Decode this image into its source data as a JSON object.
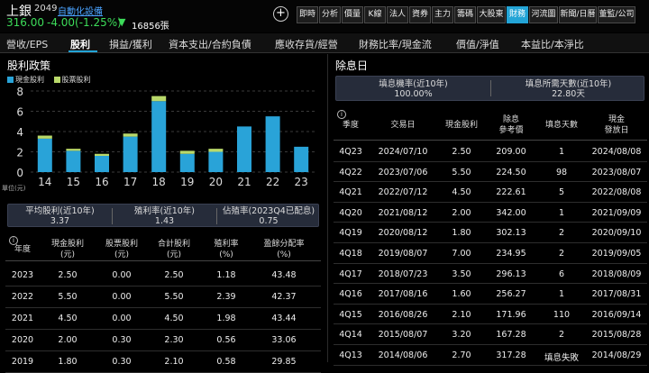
{
  "stock": {
    "name": "上銀",
    "code": "2049",
    "industry": "自動化設備",
    "price": "316.00",
    "change": "-4.00(-1.25%)",
    "arrow": "▼",
    "volume": "16856張"
  },
  "toolbar": {
    "plus": "+",
    "buttons": [
      "即時",
      "分析",
      "價量",
      "K線",
      "法人",
      "資券",
      "主力",
      "籌碼",
      "大股東",
      "財務",
      "河流圖",
      "新聞/日曆",
      "董監/公司"
    ],
    "active_index": 9
  },
  "nav": {
    "items": [
      "營收/EPS",
      "股利",
      "損益/獲利",
      "資本支出/合約負債",
      "應收存貨/經營",
      "財務比率/現金流",
      "價值/淨值",
      "本益比/本淨比"
    ],
    "active_index": 1
  },
  "dividend_policy": {
    "title": "股利政策",
    "legend": [
      "現金股利",
      "股票股利"
    ],
    "unit": "單位(元)",
    "summary": [
      {
        "label": "平均股利(近10年)",
        "value": "3.37"
      },
      {
        "label": "殖利率(近10年)",
        "value": "1.43"
      },
      {
        "label": "佔殖率(2023Q4已配息)",
        "value": "0.75"
      }
    ],
    "table_headers": [
      "年度",
      "現金股利\n(元)",
      "股票股利\n(元)",
      "合計股利\n(元)",
      "殖利率\n(%)",
      "盈餘分配率\n(%)"
    ],
    "rows": [
      [
        "2023",
        "2.50",
        "0.00",
        "2.50",
        "1.18",
        "43.48"
      ],
      [
        "2022",
        "5.50",
        "0.00",
        "5.50",
        "2.39",
        "42.37"
      ],
      [
        "2021",
        "4.50",
        "0.00",
        "4.50",
        "1.98",
        "43.44"
      ],
      [
        "2020",
        "2.00",
        "0.30",
        "2.30",
        "0.56",
        "33.06"
      ],
      [
        "2019",
        "1.80",
        "0.30",
        "2.10",
        "0.58",
        "29.85"
      ]
    ]
  },
  "chart_data": {
    "type": "bar",
    "categories": [
      "14",
      "15",
      "16",
      "17",
      "18",
      "19",
      "20",
      "21",
      "22",
      "23"
    ],
    "series": [
      {
        "name": "現金股利",
        "values": [
          3.3,
          2.1,
          1.6,
          3.5,
          7.0,
          1.8,
          2.0,
          4.5,
          5.5,
          2.5
        ],
        "color": "#29a3d8"
      },
      {
        "name": "股票股利",
        "values": [
          0.3,
          0.2,
          0.2,
          0.3,
          0.5,
          0.3,
          0.3,
          0.0,
          0.0,
          0.0
        ],
        "color": "#b9d96a"
      }
    ],
    "yticks": [
      "0",
      "2",
      "4",
      "6",
      "8"
    ],
    "ylim": [
      0,
      8
    ],
    "ylabel": "單位(元)",
    "grid": true,
    "legend_position": "top-left"
  },
  "ex_dividend": {
    "title": "除息日",
    "summary": [
      {
        "label": "填息機率(近10年)",
        "value": "100.00%"
      },
      {
        "label": "填息所需天數(近10年)",
        "value": "22.80天"
      }
    ],
    "table_headers": [
      "季度",
      "交易日",
      "現金股利",
      "除息\n參考價",
      "填息天數",
      "現金\n發放日"
    ],
    "rows": [
      [
        "4Q23",
        "2024/07/10",
        "2.50",
        "209.00",
        "1",
        "2024/08/08"
      ],
      [
        "4Q22",
        "2023/07/06",
        "5.50",
        "224.50",
        "98",
        "2023/08/07"
      ],
      [
        "4Q21",
        "2022/07/12",
        "4.50",
        "222.61",
        "5",
        "2022/08/08"
      ],
      [
        "4Q20",
        "2021/08/12",
        "2.00",
        "342.00",
        "1",
        "2021/09/09"
      ],
      [
        "4Q19",
        "2020/08/12",
        "1.80",
        "302.13",
        "2",
        "2020/09/10"
      ],
      [
        "4Q18",
        "2019/08/07",
        "7.00",
        "234.95",
        "2",
        "2019/09/05"
      ],
      [
        "4Q17",
        "2018/07/23",
        "3.50",
        "296.13",
        "6",
        "2018/08/09"
      ],
      [
        "4Q16",
        "2017/08/16",
        "1.60",
        "256.27",
        "1",
        "2017/08/31"
      ],
      [
        "4Q15",
        "2016/08/26",
        "2.10",
        "171.96",
        "110",
        "2016/09/14"
      ],
      [
        "4Q14",
        "2015/08/07",
        "3.20",
        "167.28",
        "2",
        "2015/08/28"
      ],
      [
        "4Q13",
        "2014/08/06",
        "2.70",
        "317.28",
        "填息失敗",
        "2014/08/29"
      ]
    ]
  }
}
